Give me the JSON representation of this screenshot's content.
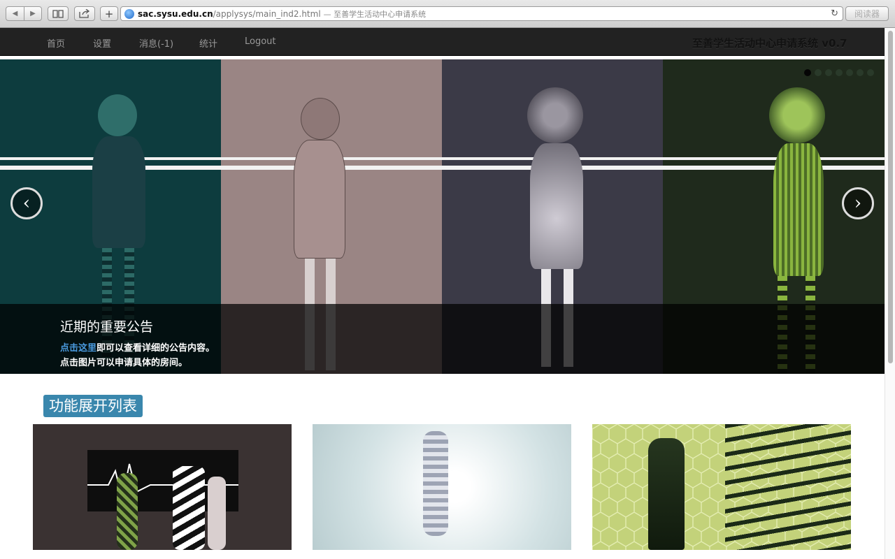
{
  "browser": {
    "url_host": "sac.sysu.edu.cn",
    "url_path": "/applysys/main_ind2.html",
    "page_title": "— 至善学生活动中心申请系统",
    "reader_label": "阅读器",
    "add_label": "+"
  },
  "navbar": {
    "items": [
      {
        "label": "首页"
      },
      {
        "label": "设置"
      },
      {
        "label": "消息(-1)"
      },
      {
        "label": "统计"
      },
      {
        "label": "Logout"
      }
    ],
    "brand": "至善学生活动中心申请系统 v0.7"
  },
  "carousel": {
    "caption_title": "近期的重要公告",
    "caption_link": "点击这里",
    "caption_line1_rest": "即可以查看详细的公告内容。",
    "caption_line2": "点击图片可以申请具体的房间。",
    "prev_label": "‹",
    "next_label": "›",
    "slide_count": 7,
    "active_index": 0,
    "panel_colors": [
      "#0d3c3e",
      "#9a8584",
      "#3b3a47",
      "#1f2a1c"
    ]
  },
  "section": {
    "heading": "功能展开列表"
  },
  "thumbnails": [
    {
      "name": "thumbnail-umbrella-scene",
      "bg": "#3a3232"
    },
    {
      "name": "thumbnail-light-scene",
      "bg": "#dce8ea"
    },
    {
      "name": "thumbnail-hexagon-stairs-scene",
      "bg": "#c3d27a"
    }
  ]
}
